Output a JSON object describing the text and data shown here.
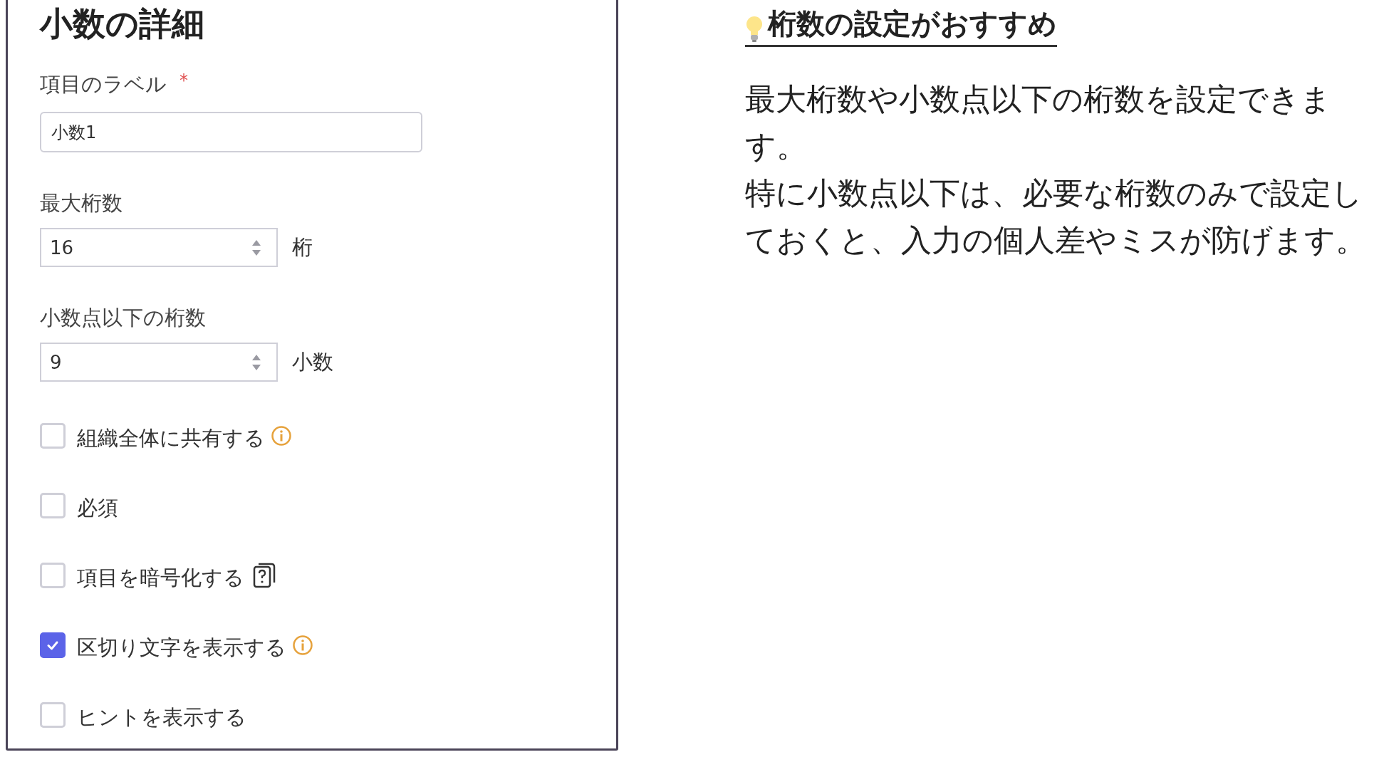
{
  "panel": {
    "title": "小数の詳細",
    "label_field": {
      "label": "項目のラベル",
      "required_mark": "*",
      "value": "小数1"
    },
    "number_fields": [
      {
        "label": "最大桁数",
        "value": "16",
        "unit": "桁"
      },
      {
        "label": "小数点以下の桁数",
        "value": "9",
        "unit": "小数"
      }
    ],
    "options": [
      {
        "label": "組織全体に共有する",
        "checked": false,
        "kind": "info"
      },
      {
        "label": "必須",
        "checked": false
      },
      {
        "label": "項目を暗号化する",
        "checked": false,
        "kind": "help"
      },
      {
        "label": "区切り文字を表示する",
        "checked": true,
        "kind": "info"
      },
      {
        "label": "ヒントを表示する",
        "checked": false
      }
    ]
  },
  "tip": {
    "title": "桁数の設定がおすすめ",
    "paragraphs": [
      "最大桁数や小数点以下の桁数を設定できます。",
      "特に小数点以下は、必要な桁数のみで設定しておくと、入力の個人差やミスが防げます。"
    ]
  }
}
